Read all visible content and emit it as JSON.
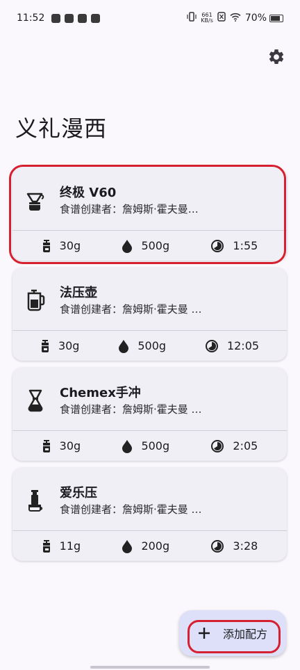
{
  "status_bar": {
    "time": "11:52",
    "net_speed_value": "661",
    "net_speed_unit": "KB/s",
    "battery": "70%"
  },
  "page": {
    "title": "义礼漫西"
  },
  "recipes": [
    {
      "name": "终极 V60",
      "author": "食谱创建者：詹姆斯·霍夫曼…",
      "icon": "v60-dripper-icon",
      "coffee": "30g",
      "water": "500g",
      "time": "1:55"
    },
    {
      "name": "法压壶",
      "author": "食谱创建者：詹姆斯·霍夫曼 …",
      "icon": "french-press-icon",
      "coffee": "30g",
      "water": "500g",
      "time": "12:05"
    },
    {
      "name": "Chemex手冲",
      "author": "食谱创建者：詹姆斯·霍夫曼 …",
      "icon": "chemex-icon",
      "coffee": "30g",
      "water": "500g",
      "time": "2:05"
    },
    {
      "name": "爱乐压",
      "author": "食谱创建者：詹姆斯·霍夫曼 …",
      "icon": "aeropress-icon",
      "coffee": "11g",
      "water": "200g",
      "time": "3:28"
    }
  ],
  "fab": {
    "label": "添加配方",
    "icon": "plus-icon"
  },
  "colors": {
    "background": "#fbf8fd",
    "card": "#f0eff5",
    "fab": "#dde0f8",
    "highlight": "#d6202f"
  }
}
